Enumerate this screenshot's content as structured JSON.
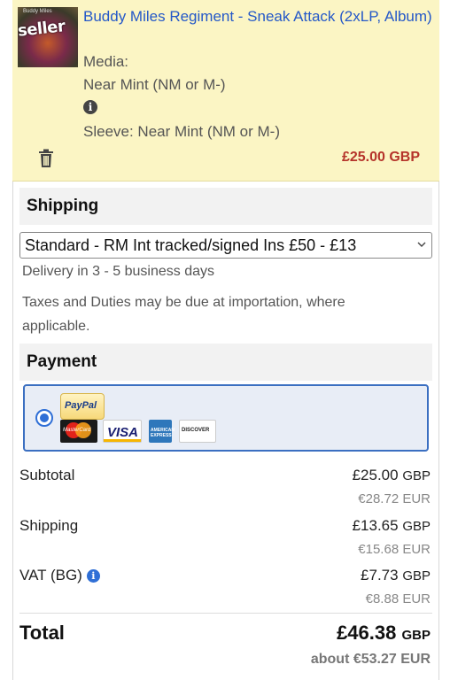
{
  "item": {
    "thumb_label": "seller",
    "title": "Buddy Miles Regiment - Sneak Attack (2xLP, Album)",
    "media_label": "Media:",
    "media_value": "Near Mint (NM or M-)",
    "sleeve": "Sleeve: Near Mint (NM or M-)",
    "price": "£25.00 GBP",
    "icons": {
      "info": "info-icon",
      "delete": "trash-icon"
    }
  },
  "shipping": {
    "heading": "Shipping",
    "selected_option": "Standard - RM Int tracked/signed Ins £50 - £13",
    "delivery": "Delivery in 3 - 5 business days",
    "taxes_note": "Taxes and Duties may be due at importation, where applicable."
  },
  "payment": {
    "heading": "Payment",
    "methods": {
      "paypal": "PayPal",
      "mastercard": "MasterCard",
      "visa": "VISA",
      "amex": "AMERICAN EXPRESS",
      "discover": "DISCOVER"
    },
    "accent_color": "#3b6fc1"
  },
  "totals": {
    "subtotal_label": "Subtotal",
    "subtotal_value": "£25.00",
    "subtotal_currency": "GBP",
    "subtotal_eur": "€28.72 EUR",
    "shipping_label": "Shipping",
    "shipping_value": "£13.65",
    "shipping_currency": "GBP",
    "shipping_eur": "€15.68 EUR",
    "vat_label": "VAT (BG)",
    "vat_value": "£7.73",
    "vat_currency": "GBP",
    "vat_eur": "€8.88 EUR",
    "total_label": "Total",
    "total_value": "£46.38",
    "total_currency": "GBP",
    "about_eur": "about €53.27 EUR"
  },
  "colors": {
    "item_bg": "#fbf5c4",
    "price": "#b5332a",
    "link": "#2458c8"
  }
}
